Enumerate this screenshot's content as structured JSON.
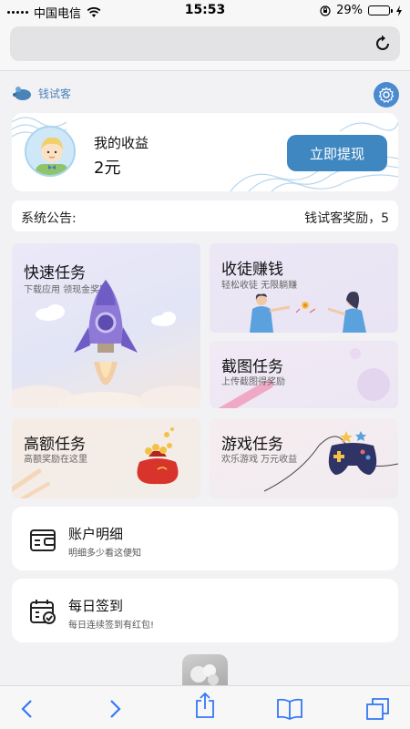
{
  "status_bar": {
    "carrier": "中国电信",
    "time": "15:53",
    "battery_percent": "29%",
    "battery_level": 0.29
  },
  "header": {
    "logo_text": "钱试客",
    "settings_icon": "gear-icon"
  },
  "earnings": {
    "title": "我的收益",
    "value": "2元",
    "withdraw_label": "立即提现"
  },
  "notice": {
    "label": "系统公告:",
    "text": "钱试客奖励，5"
  },
  "tasks": {
    "quick": {
      "title": "快速任务",
      "subtitle": "下载应用  领现金奖励"
    },
    "recruit": {
      "title": "收徒赚钱",
      "subtitle": "轻松收徒  无限躺赚"
    },
    "screenshot": {
      "title": "截图任务",
      "subtitle": "上传截图得奖励"
    },
    "high": {
      "title": "高额任务",
      "subtitle": "高额奖励在这里"
    },
    "game": {
      "title": "游戏任务",
      "subtitle": "欢乐游戏  万元收益"
    }
  },
  "list": {
    "account": {
      "title": "账户明细",
      "subtitle": "明细多少看这便知"
    },
    "checkin": {
      "title": "每日签到",
      "subtitle": "每日连续签到有红包!"
    }
  },
  "colors": {
    "accent": "#3f87c0",
    "gear_bg": "#4b8ad0"
  }
}
